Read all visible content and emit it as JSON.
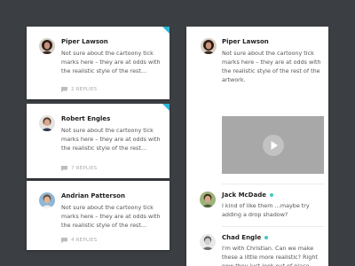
{
  "feed": {
    "cards": [
      {
        "author": "Piper Lawson",
        "text": "Not sure about the cartoony tick\nmarks here – they are at odds with\nthe realistic style of the rest…",
        "replies": "2 REPLIES"
      },
      {
        "author": "Robert Engles",
        "text": "Not sure about the cartoony tick\nmarks here – they are at odds with\nthe realistic style of the rest…",
        "replies": "7 REPLIES"
      },
      {
        "author": "Andrian Patterson",
        "text": "Not sure about the cartoony tick\nmarks here – they are at odds with\nthe realistic style of the rest…",
        "replies": "4 REPLIES"
      }
    ]
  },
  "thread": {
    "author": "Piper Lawson",
    "text": "Not sure about the cartoony tick\nmarks here – they are at odds with\nthe realistic style of the rest of the\nartwork.",
    "replies": [
      {
        "author": "Jack McDade",
        "text": "I kind of like them …maybe try\nadding a drop shadow?"
      },
      {
        "author": "Chad Engle",
        "text": "I'm with Christian. Can we make\nthese a little more realistic? Right\nnow they just look out of place."
      }
    ]
  },
  "colors": {
    "background": "#3b3e42",
    "accent_corner": "#29b6d8",
    "online_dot": "#3ccac0",
    "video_placeholder": "#a8a8a8"
  },
  "icons": {
    "reply_count": "speech-bubble-icon",
    "video": "play-icon",
    "corner": "unread-corner-marker"
  }
}
